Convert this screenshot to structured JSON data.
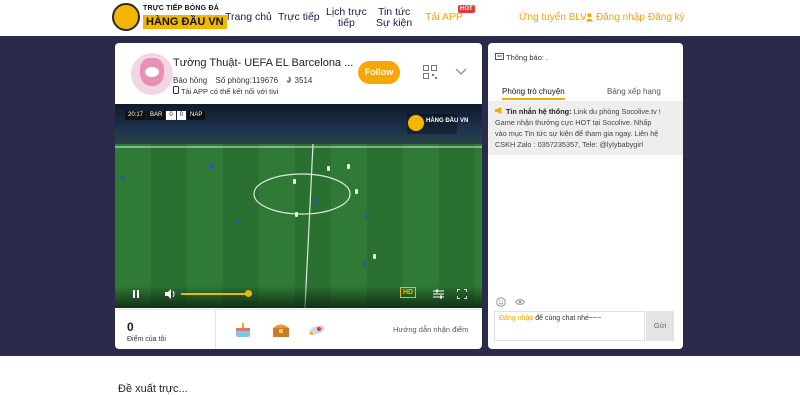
{
  "header": {
    "logo_line1": "TRỰC TIẾP BÓNG ĐÁ",
    "logo_line2": "HÀNG ĐẦU VN",
    "nav": [
      {
        "label": "Trang chủ"
      },
      {
        "label": "Trực tiếp"
      },
      {
        "label_line1": "Lịch trực",
        "label_line2": "tiếp"
      },
      {
        "label_line1": "Tin tức",
        "label_line2": "Sự kiện"
      },
      {
        "label": "Tải APP"
      }
    ],
    "hot_badge": "HOT",
    "recruit": "Ứng tuyển BLV",
    "login": "Đăng nhập",
    "register": "Đăng ký"
  },
  "stream": {
    "title": "Tường Thuật- UEFA EL Barcelona ...",
    "streamer": "Báo hồng",
    "room": "Số phòng:119676",
    "viewers": "3514",
    "viewer_icon": "fire-icon",
    "note": "Tải APP có thể kết nối với tivi",
    "follow": "Follow"
  },
  "video": {
    "time": "20:17",
    "home": "BAR",
    "home_score": "0",
    "away_score": "0",
    "away": "NAP",
    "hd": "HD",
    "volume_level": 0.95
  },
  "panel_footer": {
    "points": "0",
    "points_label": "Điểm của tôi",
    "guide": "Hướng dẫn nhận điểm",
    "gifts": [
      "cake-icon",
      "treasure-chest-icon",
      "rocket-icon"
    ]
  },
  "chat": {
    "notice": "Thông báo: .",
    "tab_chat": "Phòng trò chuyện",
    "tab_rank": "Bảng xếp hạng",
    "sys_head": "Tin nhắn hệ thống:",
    "sys_line1": " Link du phòng Socolive.tv !",
    "sys_line2": "Game nhận thưởng cực HOT tại Socolive. Nhấp",
    "sys_line3": "vào mục Tin tức sự kiện để tham gia ngay. Liên hệ",
    "sys_line4": "CSKH Zalo : 0357235357, Tele: @lylybabygirl",
    "input_login": "Đăng nhập",
    "input_rest": " để cùng chat nhé~~~",
    "send": "Gửi"
  },
  "bottom_text": "Đề xuất trực..."
}
